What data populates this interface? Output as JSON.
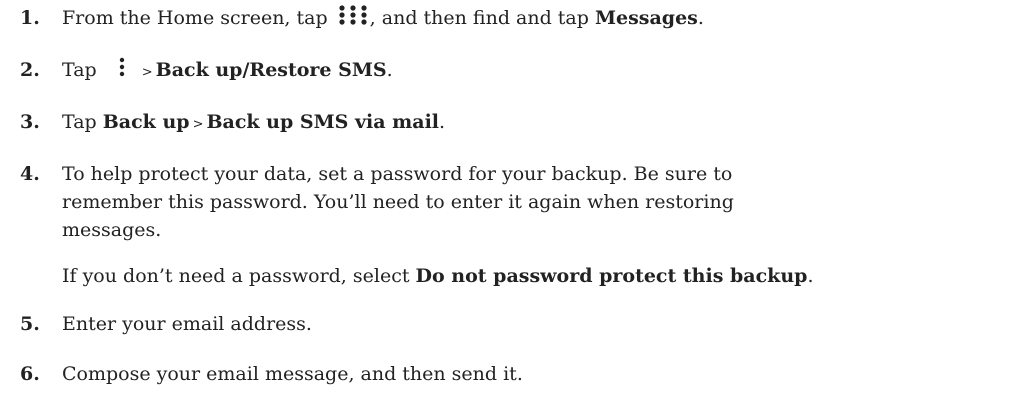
{
  "steps": [
    {
      "num": "1.",
      "t1": "From the Home screen, tap ",
      "icon": "apps-grid-icon",
      "t2": ", and then find and tap ",
      "b1": "Messages",
      "t3": "."
    },
    {
      "num": "2.",
      "t1": "Tap ",
      "icon": "more-vertical-icon",
      "sep": ">",
      "b1": "Back up/Restore SMS",
      "t2": "."
    },
    {
      "num": "3.",
      "t1": "Tap ",
      "b1": "Back up",
      "sep": ">",
      "b2": "Back up SMS via mail",
      "t2": "."
    },
    {
      "num": "4.",
      "p1": "To help protect your data, set a password for your backup. Be sure to remember this password. You’ll need to enter it again when restoring messages.",
      "p2_t1": "If you don’t need a password, select ",
      "p2_b1": "Do not password protect this backup",
      "p2_t2": "."
    },
    {
      "num": "5.",
      "t1": "Enter your email address."
    },
    {
      "num": "6.",
      "t1": "Compose your email message, and then send it."
    }
  ]
}
